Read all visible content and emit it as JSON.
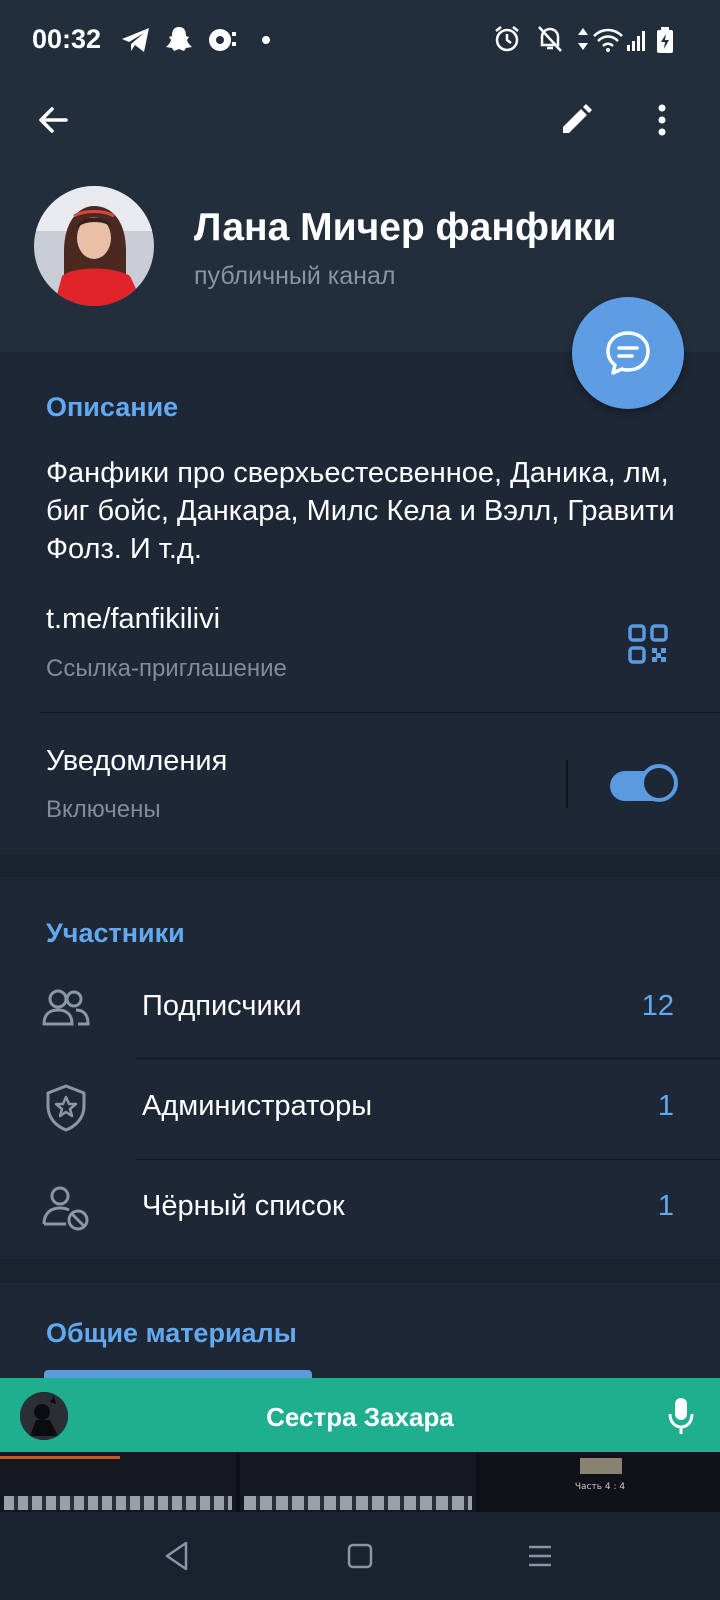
{
  "status_bar": {
    "time": "00:32"
  },
  "toolbar": {
    "back_icon": "arrow-left-icon",
    "edit_icon": "pencil-icon",
    "more_icon": "more-vertical-icon"
  },
  "channel": {
    "name": "Лана Мичер фанфики",
    "subtitle": "публичный канал"
  },
  "description": {
    "title": "Описание",
    "text": "Фанфики про сверхьестесвенное, Даника, лм, биг бойс, Данкара, Милс Кела и Вэлл, Гравити Фолз. И т.д."
  },
  "invite_link": {
    "url": "t.me/fanfikilivi",
    "label": "Ссылка-приглашение",
    "icon": "qr-code-icon"
  },
  "notifications": {
    "title": "Уведомления",
    "status": "Включены",
    "enabled": true
  },
  "members": {
    "title": "Участники",
    "rows": [
      {
        "label": "Подписчики",
        "count": "12",
        "icon": "people-icon"
      },
      {
        "label": "Администраторы",
        "count": "1",
        "icon": "shield-star-icon"
      },
      {
        "label": "Чёрный список",
        "count": "1",
        "icon": "user-blocked-icon"
      }
    ]
  },
  "shared_media": {
    "title": "Общие материалы"
  },
  "now_playing": {
    "title": "Сестра Захара",
    "icon": "microphone-icon"
  },
  "media_thumbs": {
    "third_caption": "Часть 4 : 4"
  },
  "colors": {
    "accent": "#63a9f0",
    "header_bg": "#232e3c",
    "section_bg": "#1e2735",
    "fab": "#5d9de4",
    "now_playing_bg": "#1fae8e"
  }
}
